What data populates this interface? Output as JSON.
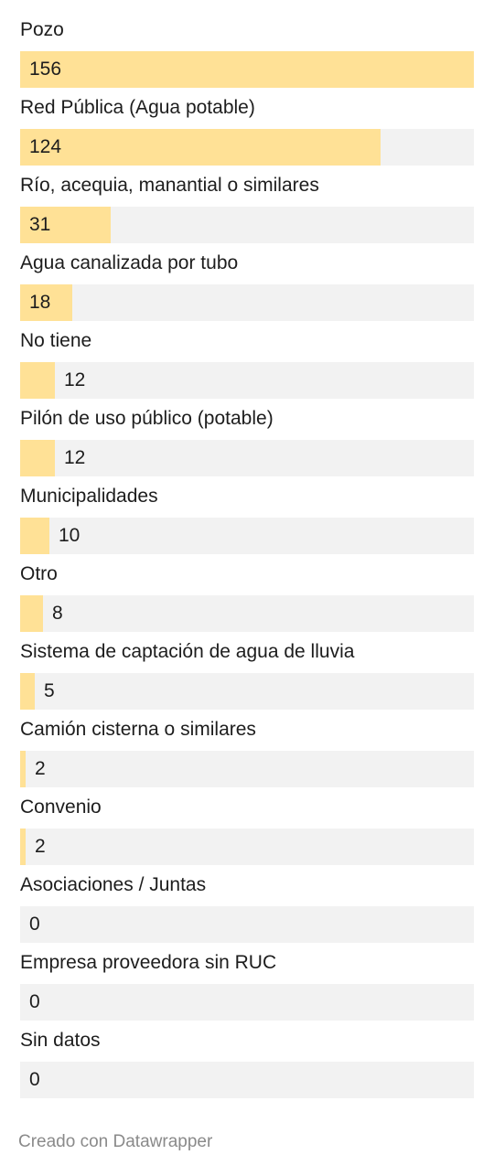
{
  "chart_data": {
    "type": "bar",
    "orientation": "horizontal",
    "categories": [
      "Pozo",
      "Red Pública (Agua potable)",
      "Río, acequia, manantial o similares",
      "Agua canalizada por tubo",
      "No tiene",
      "Pilón de uso público (potable)",
      "Municipalidades",
      "Otro",
      "Sistema de captación de agua de lluvia",
      "Camión cisterna o similares",
      "Convenio",
      "Asociaciones / Juntas",
      "Empresa proveedora sin RUC",
      "Sin datos"
    ],
    "values": [
      156,
      124,
      31,
      18,
      12,
      12,
      10,
      8,
      5,
      2,
      2,
      0,
      0,
      0
    ],
    "xlim": [
      0,
      156
    ],
    "grid": false,
    "colors": {
      "bar": "#ffe196",
      "track": "#f2f2f2",
      "text": "#1d1d1d"
    }
  },
  "footer": {
    "credit": "Creado con Datawrapper"
  }
}
